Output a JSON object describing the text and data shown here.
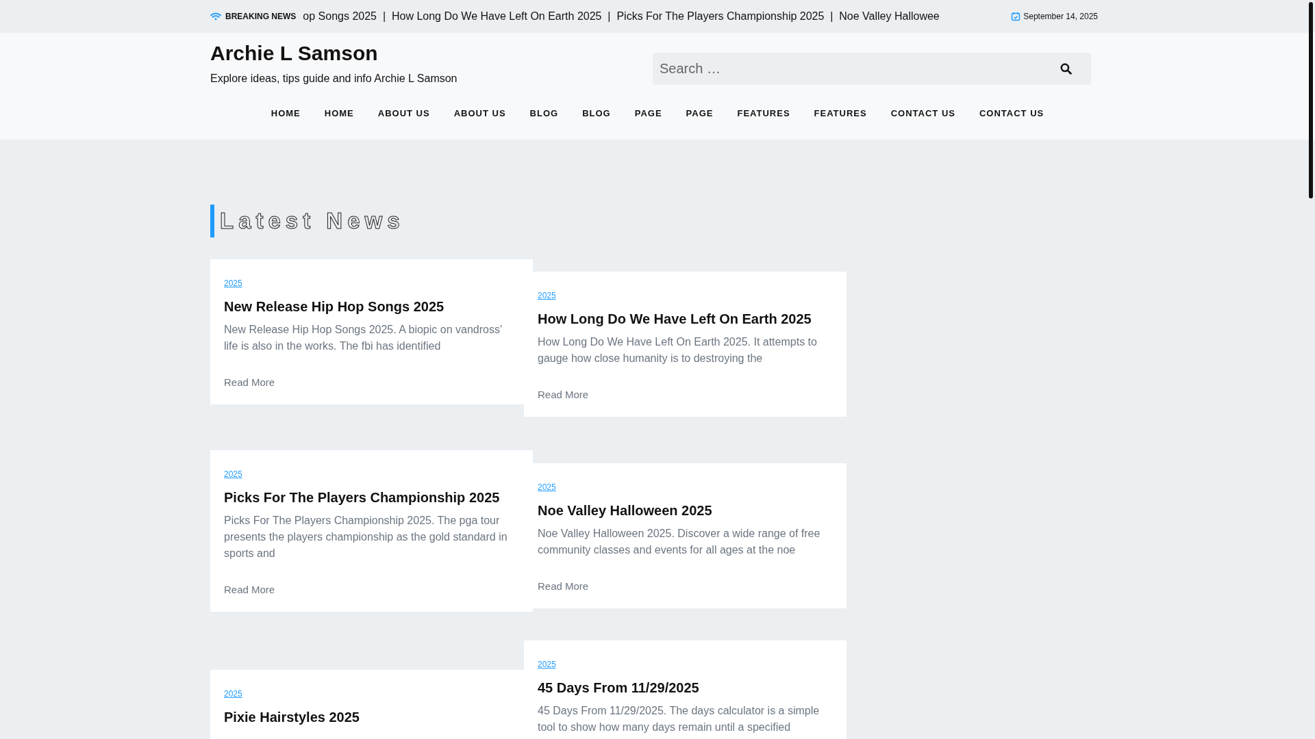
{
  "topbar": {
    "breaking_label": "BREAKING NEWS",
    "ticker": "op Songs 2025  |  How Long Do We Have Left On Earth 2025  |  Picks For The Players Championship 2025  |  Noe Valley Hallowee",
    "date": "September 14, 2025"
  },
  "header": {
    "site_title": "Archie L Samson",
    "tagline": "Explore ideas, tips guide and info Archie L Samson",
    "search": {
      "placeholder": "Search …"
    }
  },
  "nav": [
    "HOME",
    "HOME",
    "ABOUT US",
    "ABOUT US",
    "BLOG",
    "BLOG",
    "PAGE",
    "PAGE",
    "FEATURES",
    "FEATURES",
    "CONTACT US",
    "CONTACT US"
  ],
  "section_title": "Latest News",
  "posts": [
    {
      "year": "2025",
      "title": "New Release Hip Hop Songs 2025",
      "excerpt": "New Release Hip Hop Songs 2025. A biopic on vandross' life is also in the works. The fbi has identified",
      "read_more": "Read More"
    },
    {
      "year": "2025",
      "title": "How Long Do We Have Left On Earth 2025",
      "excerpt": "How Long Do We Have Left On Earth 2025. It attempts to gauge how close humanity is to destroying the",
      "read_more": "Read More"
    },
    {
      "year": "2025",
      "title": "Picks For The Players Championship 2025",
      "excerpt": "Picks For The Players Championship 2025. The pga tour presents the players championship as the gold standard in sports and",
      "read_more": "Read More"
    },
    {
      "year": "2025",
      "title": "Noe Valley Halloween 2025",
      "excerpt": "Noe Valley Halloween 2025. Discover a wide range of free community classes and events for all ages at the noe",
      "read_more": "Read More"
    },
    {
      "year": "2025",
      "title": "Pixie Hairstyles 2025"
    },
    {
      "year": "2025",
      "title": "45 Days From 11/29/2025",
      "excerpt": "45 Days From 11/29/2025. The days calculator is a simple tool to show how many days remain until a specified"
    }
  ]
}
